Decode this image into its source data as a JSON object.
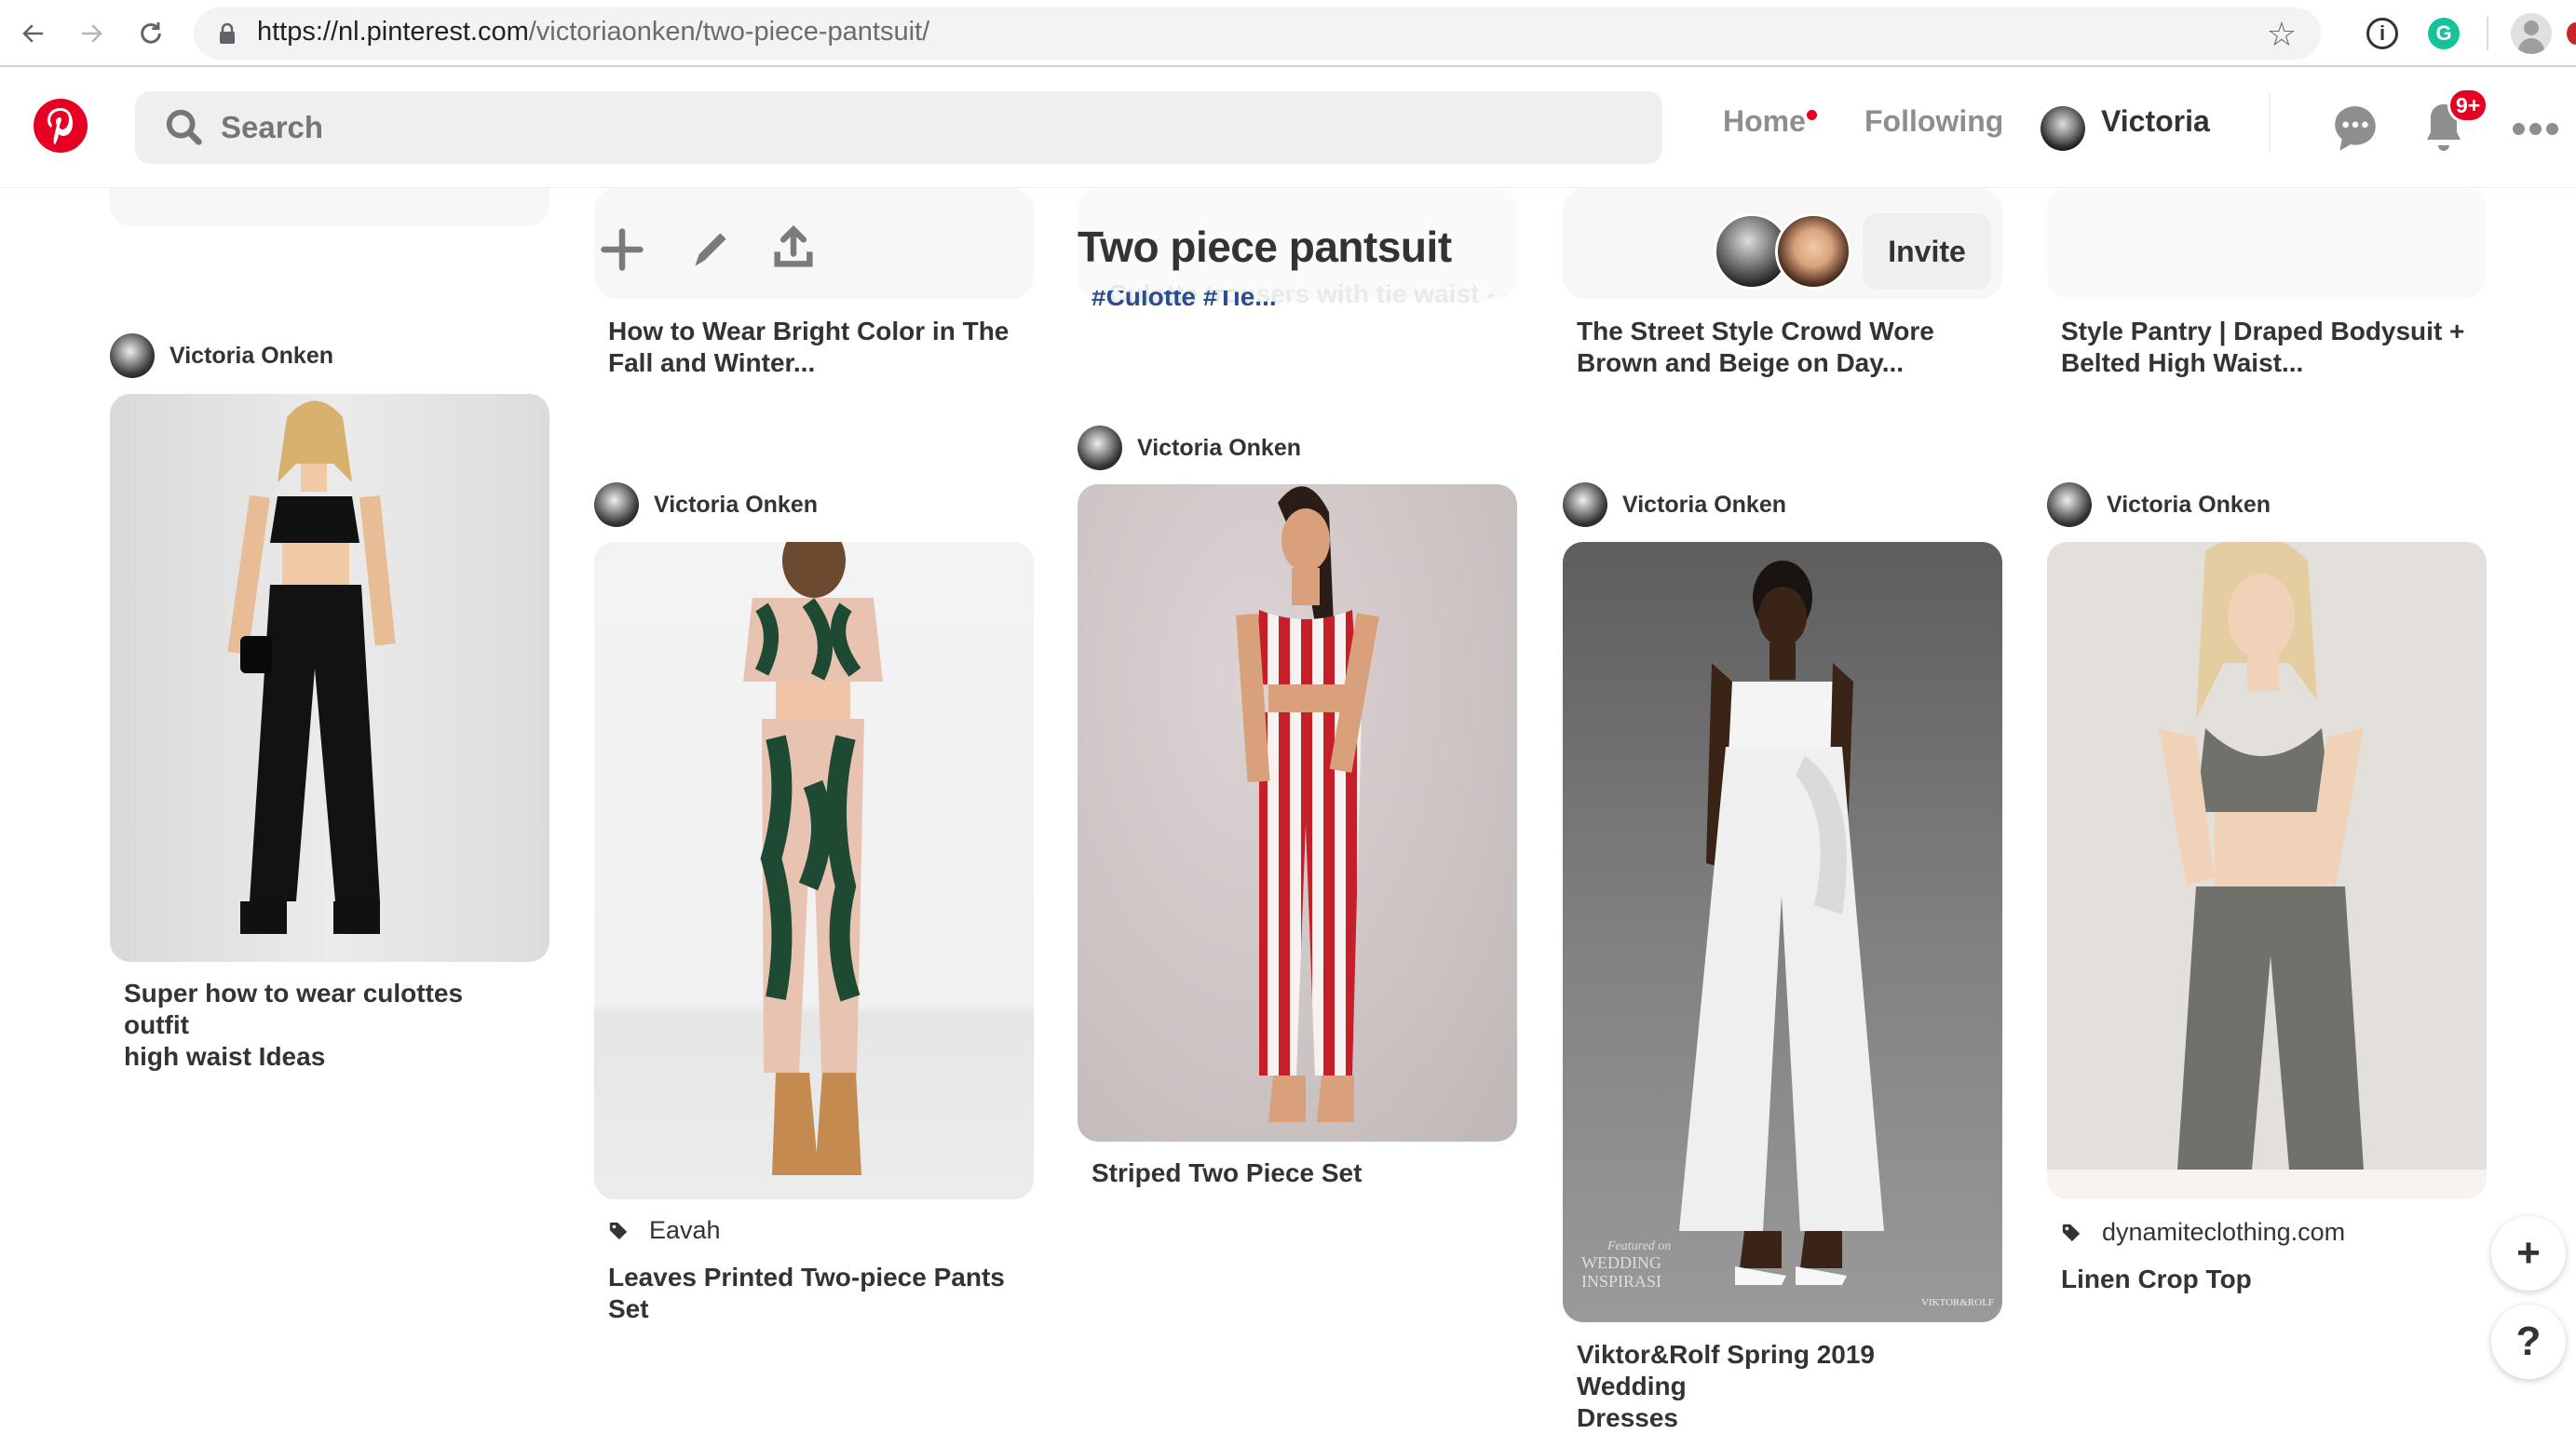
{
  "browser": {
    "url_host": "https://nl.pinterest.com",
    "url_path": "/victoriaonken/two-piece-pantsuit/"
  },
  "header": {
    "search_placeholder": "Search",
    "nav": {
      "home": "Home",
      "following": "Following",
      "user": "Victoria"
    },
    "notifications_badge": "9+"
  },
  "board": {
    "title": "Two piece pantsuit",
    "faded_description": "Culotte trousers with tie waist -",
    "faded_hashtags": "#Culotte #Tie...",
    "invite_label": "Invite"
  },
  "pins": [
    {
      "column": 1,
      "author": "Victoria Onken",
      "title": "Super how to wear culottes outfit high waist Ideas",
      "title_lines": [
        "Super how to wear culottes outfit",
        "high waist Ideas"
      ]
    },
    {
      "column": 2,
      "title_lines": [
        "How to Wear Bright Color in The",
        "Fall and Winter..."
      ]
    },
    {
      "column": 2,
      "author": "Victoria Onken",
      "source": "Eavah",
      "title_lines": [
        "Leaves Printed Two-piece Pants",
        "Set"
      ]
    },
    {
      "column": 3,
      "author": "Victoria Onken",
      "title_lines": [
        "Striped Two Piece Set"
      ]
    },
    {
      "column": 4,
      "title_lines": [
        "The Street Style Crowd Wore",
        "Brown and Beige on Day..."
      ]
    },
    {
      "column": 4,
      "author": "Victoria Onken",
      "title_lines": [
        "Viktor&Rolf Spring 2019 Wedding",
        "Dresses"
      ],
      "watermark": [
        "Featured on",
        "WEDDING",
        "INSPIRASI",
        "VIKTOR&ROLF"
      ]
    },
    {
      "column": 5,
      "title_lines": [
        "Style Pantry | Draped Bodysuit +",
        "Belted High Waist..."
      ]
    },
    {
      "column": 5,
      "author": "Victoria Onken",
      "source": "dynamiteclothing.com",
      "title_lines": [
        "Linen Crop Top"
      ]
    }
  ],
  "fab": {
    "add": "+",
    "help": "?"
  },
  "colors": {
    "brand": "#e60023",
    "grammarly": "#15c39a"
  }
}
